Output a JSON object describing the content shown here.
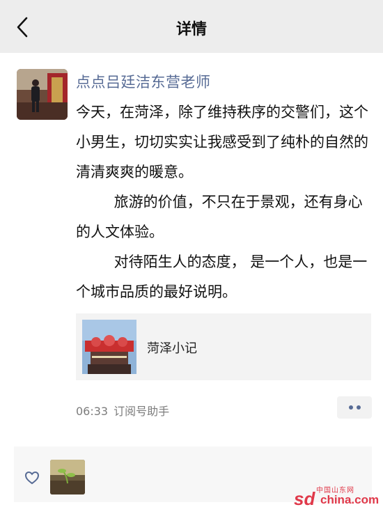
{
  "header": {
    "title": "详情",
    "back_icon": "chevron-left-icon"
  },
  "post": {
    "author": "点点吕廷洁东营老师",
    "paragraphs": [
      "今天，在菏泽，除了维持秩序的交警们，这个小男生，切切实实让我感受到了纯朴的自然的清清爽爽的暖意。",
      "旅游的价值，不只在于景观，还有身心的人文体验。",
      "对待陌生人的态度， 是一个人，也是一个城市品质的最好说明。"
    ],
    "link_card": {
      "title": "菏泽小记"
    },
    "time": "06:33",
    "source": "订阅号助手",
    "more_icon": "more-dots-icon"
  },
  "likes": {
    "like_icon": "heart-icon"
  },
  "watermark": {
    "cn": "中国山东网",
    "sd": "sd",
    "domain": "china.com"
  },
  "colors": {
    "topbar": "#ededed",
    "author": "#576b95",
    "meta": "#7c7c7c",
    "watermark": "#e0394a"
  }
}
